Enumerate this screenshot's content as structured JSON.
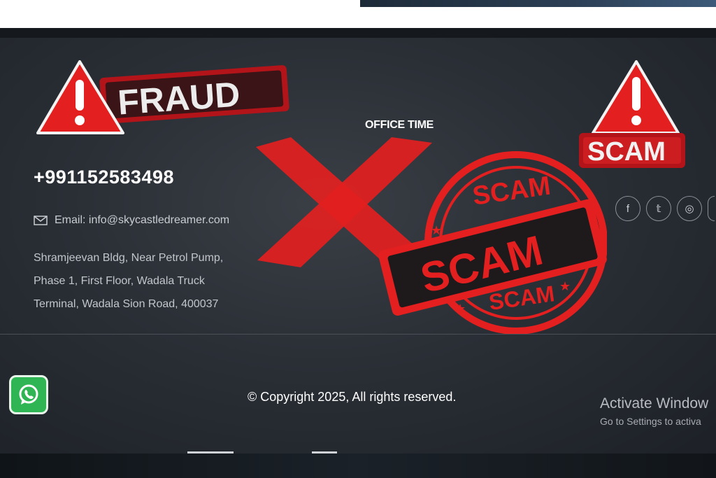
{
  "footer": {
    "office_time_heading": "OFFICE TIME",
    "phone": "+991152583498",
    "email_label": "Email: info@skycastledreamer.com",
    "address_lines": [
      "Shramjeevan Bldg, Near Petrol Pump,",
      "Phase 1, First Floor, Wadala Truck",
      "Terminal, Wadala Sion Road, 400037"
    ],
    "socials": [
      {
        "icon": "facebook-icon",
        "glyph": "f"
      },
      {
        "icon": "twitter-icon",
        "glyph": "𝕥"
      },
      {
        "icon": "instagram-icon",
        "glyph": "◎"
      }
    ],
    "copyright": "© Copyright 2025,  All rights reserved."
  },
  "overlay": {
    "fraud_label": "FRAUD",
    "scam_label": "SCAM",
    "stamp_top": "SCAM",
    "stamp_center": "SCAM",
    "stamp_bottom": "SCAM",
    "alert_color": "#e3201f"
  },
  "windows_watermark": {
    "title": "Activate Window",
    "subtitle": "Go to Settings to activa"
  },
  "whatsapp": {
    "icon": "whatsapp-icon",
    "color": "#2fb553"
  }
}
